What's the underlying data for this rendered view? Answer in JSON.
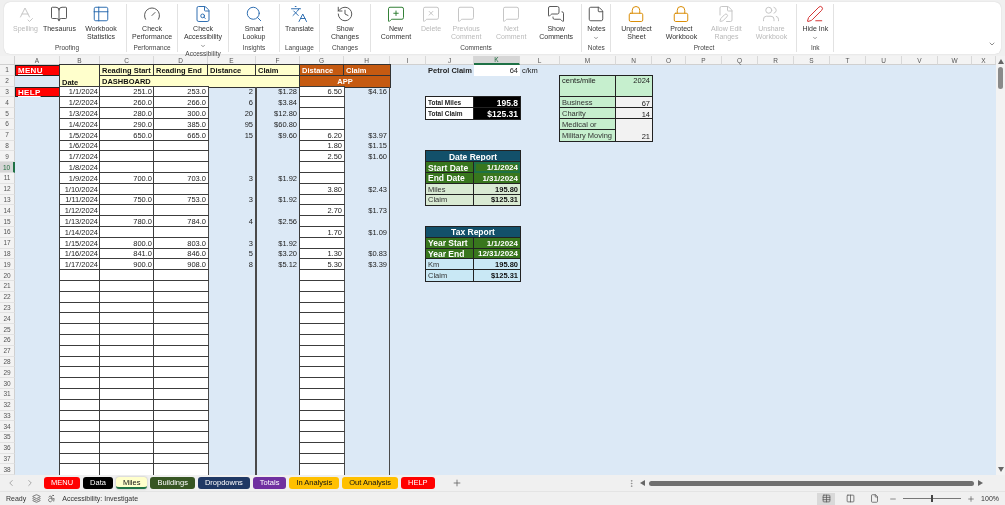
{
  "ribbon": {
    "groups": [
      {
        "label": "Proofing",
        "buttons": [
          {
            "label": "Spelling",
            "disabled": true
          },
          {
            "label": "Thesaurus",
            "disabled": false
          },
          {
            "label": "Workbook Statistics",
            "disabled": false
          }
        ]
      },
      {
        "label": "Performance",
        "buttons": [
          {
            "label": "Check Performance",
            "disabled": false
          }
        ]
      },
      {
        "label": "Accessibility",
        "buttons": [
          {
            "label": "Check Accessibility",
            "disabled": false,
            "dropdown": true
          }
        ]
      },
      {
        "label": "Insights",
        "buttons": [
          {
            "label": "Smart Lookup",
            "disabled": false
          }
        ]
      },
      {
        "label": "Language",
        "buttons": [
          {
            "label": "Translate",
            "disabled": false
          }
        ]
      },
      {
        "label": "Changes",
        "buttons": [
          {
            "label": "Show Changes",
            "disabled": false
          }
        ]
      },
      {
        "label": "Comments",
        "buttons": [
          {
            "label": "New Comment",
            "disabled": false
          },
          {
            "label": "Delete",
            "disabled": true
          },
          {
            "label": "Previous Comment",
            "disabled": true
          },
          {
            "label": "Next Comment",
            "disabled": true
          },
          {
            "label": "Show Comments",
            "disabled": false
          }
        ]
      },
      {
        "label": "Notes",
        "buttons": [
          {
            "label": "Notes",
            "disabled": false,
            "dropdown": true
          }
        ]
      },
      {
        "label": "Protect",
        "buttons": [
          {
            "label": "Unprotect Sheet",
            "disabled": false
          },
          {
            "label": "Protect Workbook",
            "disabled": false
          },
          {
            "label": "Allow Edit Ranges",
            "disabled": true
          },
          {
            "label": "Unshare Workbook",
            "disabled": true
          }
        ]
      },
      {
        "label": "Ink",
        "buttons": [
          {
            "label": "Hide Ink",
            "disabled": false,
            "dropdown": true
          }
        ]
      }
    ]
  },
  "sheet": {
    "columns": [
      {
        "label": "A",
        "selected": false
      },
      {
        "label": "B",
        "selected": false
      },
      {
        "label": "C",
        "selected": false
      },
      {
        "label": "D",
        "selected": false
      },
      {
        "label": "E",
        "selected": false
      },
      {
        "label": "F",
        "selected": false
      },
      {
        "label": "G",
        "selected": false
      },
      {
        "label": "H",
        "selected": false
      },
      {
        "label": "I",
        "selected": false
      },
      {
        "label": "J",
        "selected": false
      },
      {
        "label": "K",
        "selected": true
      },
      {
        "label": "L",
        "selected": false
      },
      {
        "label": "M",
        "selected": false
      },
      {
        "label": "N",
        "selected": false
      },
      {
        "label": "O",
        "selected": false
      },
      {
        "label": "P",
        "selected": false
      },
      {
        "label": "Q",
        "selected": false
      },
      {
        "label": "R",
        "selected": false
      },
      {
        "label": "S",
        "selected": false
      },
      {
        "label": "T",
        "selected": false
      },
      {
        "label": "U",
        "selected": false
      },
      {
        "label": "V",
        "selected": false
      },
      {
        "label": "W",
        "selected": false
      },
      {
        "label": "X",
        "selected": false
      }
    ],
    "rows": [
      {
        "label": "1",
        "selected": false
      },
      {
        "label": "2",
        "selected": false
      },
      {
        "label": "3",
        "selected": false
      },
      {
        "label": "4",
        "selected": false
      },
      {
        "label": "5",
        "selected": false
      },
      {
        "label": "6",
        "selected": false
      },
      {
        "label": "7",
        "selected": false
      },
      {
        "label": "8",
        "selected": false
      },
      {
        "label": "9",
        "selected": false
      },
      {
        "label": "10",
        "selected": true
      },
      {
        "label": "11",
        "selected": false
      },
      {
        "label": "12",
        "selected": false
      },
      {
        "label": "13",
        "selected": false
      },
      {
        "label": "14",
        "selected": false
      },
      {
        "label": "15",
        "selected": false
      },
      {
        "label": "16",
        "selected": false
      },
      {
        "label": "17",
        "selected": false
      },
      {
        "label": "18",
        "selected": false
      },
      {
        "label": "19",
        "selected": false
      },
      {
        "label": "20",
        "selected": false
      },
      {
        "label": "21",
        "selected": false
      },
      {
        "label": "22",
        "selected": false
      },
      {
        "label": "23",
        "selected": false
      },
      {
        "label": "24",
        "selected": false
      },
      {
        "label": "25",
        "selected": false
      },
      {
        "label": "26",
        "selected": false
      },
      {
        "label": "27",
        "selected": false
      },
      {
        "label": "28",
        "selected": false
      },
      {
        "label": "29",
        "selected": false
      },
      {
        "label": "30",
        "selected": false
      },
      {
        "label": "31",
        "selected": false
      },
      {
        "label": "32",
        "selected": false
      },
      {
        "label": "33",
        "selected": false
      },
      {
        "label": "34",
        "selected": false
      },
      {
        "label": "35",
        "selected": false
      },
      {
        "label": "36",
        "selected": false
      },
      {
        "label": "37",
        "selected": false
      },
      {
        "label": "38",
        "selected": false
      }
    ]
  },
  "links": [
    {
      "label": "MENU"
    },
    {
      "label": "HELP"
    }
  ],
  "log": {
    "date_column": {
      "label": "Date",
      "kind": "date"
    },
    "groups": [
      {
        "label": "DASHBOARD",
        "kind": "dashboard",
        "columns": [
          {
            "label": "Reading Start",
            "kind": "input"
          },
          {
            "label": "Reading End",
            "kind": "input"
          },
          {
            "label": "Distance",
            "kind": "computed"
          },
          {
            "label": "Claim",
            "kind": "computed"
          }
        ]
      },
      {
        "label": "APP",
        "kind": "app",
        "columns": [
          {
            "label": "Distance",
            "kind": "input"
          },
          {
            "label": "Claim",
            "kind": "computed"
          }
        ]
      }
    ],
    "rows": [
      [
        "1/1/2024",
        "251.0",
        "253.0",
        "2",
        "$1.28",
        "6.50",
        "$4.16"
      ],
      [
        "1/2/2024",
        "260.0",
        "266.0",
        "6",
        "$3.84",
        null,
        null
      ],
      [
        "1/3/2024",
        "280.0",
        "300.0",
        "20",
        "$12.80",
        null,
        null
      ],
      [
        "1/4/2024",
        "290.0",
        "385.0",
        "95",
        "$60.80",
        null,
        null
      ],
      [
        "1/5/2024",
        "650.0",
        "665.0",
        "15",
        "$9.60",
        "6.20",
        "$3.97"
      ],
      [
        "1/6/2024",
        null,
        null,
        null,
        null,
        "1.80",
        "$1.15"
      ],
      [
        "1/7/2024",
        null,
        null,
        null,
        null,
        "2.50",
        "$1.60"
      ],
      [
        "1/8/2024",
        null,
        null,
        null,
        null,
        null,
        null
      ],
      [
        "1/9/2024",
        "700.0",
        "703.0",
        "3",
        "$1.92",
        null,
        null
      ],
      [
        "1/10/2024",
        null,
        null,
        null,
        null,
        "3.80",
        "$2.43"
      ],
      [
        "1/11/2024",
        "750.0",
        "753.0",
        "3",
        "$1.92",
        null,
        null
      ],
      [
        "1/12/2024",
        null,
        null,
        null,
        null,
        "2.70",
        "$1.73"
      ],
      [
        "1/13/2024",
        "780.0",
        "784.0",
        "4",
        "$2.56",
        null,
        null
      ],
      [
        "1/14/2024",
        null,
        null,
        null,
        null,
        "1.70",
        "$1.09"
      ],
      [
        "1/15/2024",
        "800.0",
        "803.0",
        "3",
        "$1.92",
        null,
        null
      ],
      [
        "1/16/2024",
        "841.0",
        "846.0",
        "5",
        "$3.20",
        "1.30",
        "$0.83"
      ],
      [
        "1/17/2024",
        "900.0",
        "908.0",
        "8",
        "$5.12",
        "5.30",
        "$3.39"
      ]
    ]
  },
  "petrol_claim": {
    "label": "Petrol Claim",
    "value": "64",
    "unit": "c/km"
  },
  "totals": [
    {
      "label": "Total Miles",
      "value": "195.8"
    },
    {
      "label": "Total Claim",
      "value": "$125.31"
    }
  ],
  "rates": {
    "header": "cents/mile",
    "year": "2024",
    "rows": [
      {
        "labels": [
          "Business"
        ],
        "value": "67"
      },
      {
        "labels": [
          "Charity"
        ],
        "value": "14"
      },
      {
        "labels": [
          "Medical or",
          "Military Moving"
        ],
        "value": "21"
      }
    ]
  },
  "reports": [
    {
      "title": "Date Report",
      "kind": "date",
      "rows": [
        {
          "kind": "header",
          "label": "Start Date",
          "value": "1/1/2024"
        },
        {
          "kind": "header",
          "label": "End Date",
          "value": "1/31/2024"
        },
        {
          "kind": "total",
          "label": "Miles",
          "value": "195.80"
        },
        {
          "kind": "total",
          "label": "Claim",
          "value": "$125.31"
        }
      ]
    },
    {
      "title": "Tax Report",
      "kind": "tax",
      "rows": [
        {
          "kind": "header",
          "label": "Year Start",
          "value": "1/1/2024"
        },
        {
          "kind": "header",
          "label": "Year End",
          "value": "12/31/2024"
        },
        {
          "kind": "total",
          "label": "Km",
          "value": "195.80"
        },
        {
          "kind": "total",
          "label": "Claim",
          "value": "$125.31"
        }
      ]
    }
  ],
  "sheet_tabs": [
    {
      "label": "MENU",
      "color": "#ff0000",
      "selected": false
    },
    {
      "label": "Data",
      "color": "#000000",
      "selected": false
    },
    {
      "label": "Miles",
      "color": "#ffffcc",
      "selected": true
    },
    {
      "label": "Buildings",
      "color": "#375623",
      "selected": false
    },
    {
      "label": "Dropdowns",
      "color": "#1f3864",
      "selected": false
    },
    {
      "label": "Totals",
      "color": "#7030a0",
      "selected": false
    },
    {
      "label": "In Analysis",
      "color": "#ffc000",
      "selected": false
    },
    {
      "label": "Out Analysis",
      "color": "#ffc000",
      "selected": false
    },
    {
      "label": "HELP",
      "color": "#ff0000",
      "selected": false
    }
  ],
  "status_bar": {
    "mode": "Ready",
    "accessibility": "Accessibility: Investigate",
    "views": [
      {
        "selected": true
      },
      {
        "selected": false
      },
      {
        "selected": false
      }
    ],
    "zoom": {
      "level": 0.5,
      "reading": "100%"
    }
  }
}
